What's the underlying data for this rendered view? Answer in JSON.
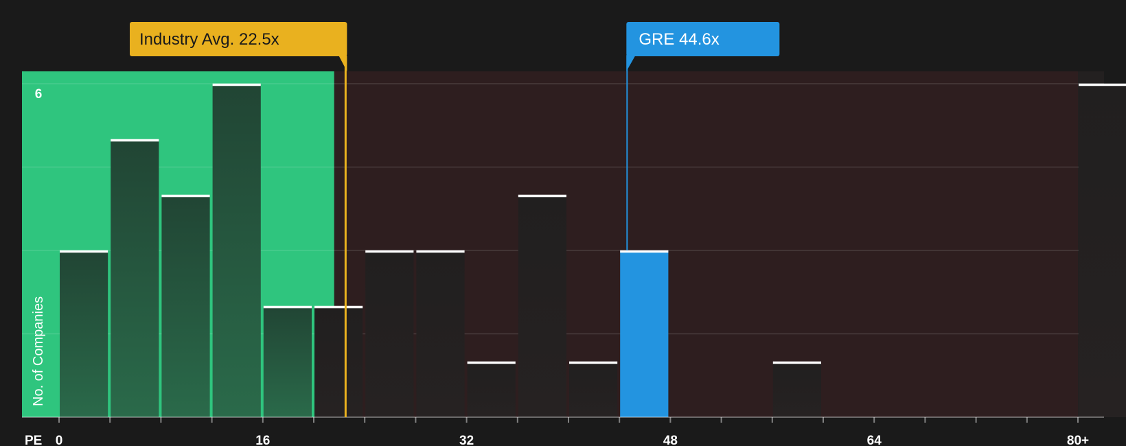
{
  "chart_data": {
    "type": "bar",
    "title": "",
    "xlabel": "PE",
    "ylabel": "No. of Companies",
    "xlim": [
      0,
      80
    ],
    "ylim": [
      0,
      6
    ],
    "bin_width": 4,
    "x_ticks": [
      {
        "value": 0,
        "label": "0"
      },
      {
        "value": 16,
        "label": "16"
      },
      {
        "value": 32,
        "label": "32"
      },
      {
        "value": 48,
        "label": "48"
      },
      {
        "value": 64,
        "label": "64"
      },
      {
        "value": 80,
        "label": "80+"
      }
    ],
    "y_ticks": [
      {
        "value": 6,
        "label": "6"
      }
    ],
    "y_gridlines": [
      1.5,
      3,
      4.5,
      6
    ],
    "bins": [
      {
        "start": 0,
        "count": 3
      },
      {
        "start": 4,
        "count": 5
      },
      {
        "start": 8,
        "count": 4
      },
      {
        "start": 12,
        "count": 6
      },
      {
        "start": 16,
        "count": 2
      },
      {
        "start": 20,
        "count": 2
      },
      {
        "start": 24,
        "count": 3
      },
      {
        "start": 28,
        "count": 3
      },
      {
        "start": 32,
        "count": 1
      },
      {
        "start": 36,
        "count": 4
      },
      {
        "start": 40,
        "count": 1
      },
      {
        "start": 44,
        "count": 3,
        "highlight": true
      },
      {
        "start": 56,
        "count": 1
      },
      {
        "start": 80,
        "count": 6
      }
    ],
    "fair_range": [
      0,
      21.6
    ],
    "industry_avg": {
      "value": 22.5,
      "label": "Industry Avg. 22.5x"
    },
    "company": {
      "value": 44.6,
      "label": "GRE 44.6x"
    },
    "colors": {
      "background": "#1a1a1a",
      "fair_zone": "#2fc57e",
      "overvalued_zone": "#2e1e1f",
      "bar_dark": "#232020",
      "bar_in_green": "#1f4a36",
      "highlight": "#2394e0",
      "industry_avg": "#e9b11f",
      "cap_line": "#ffffff",
      "axis_text": "#ffffff"
    }
  }
}
